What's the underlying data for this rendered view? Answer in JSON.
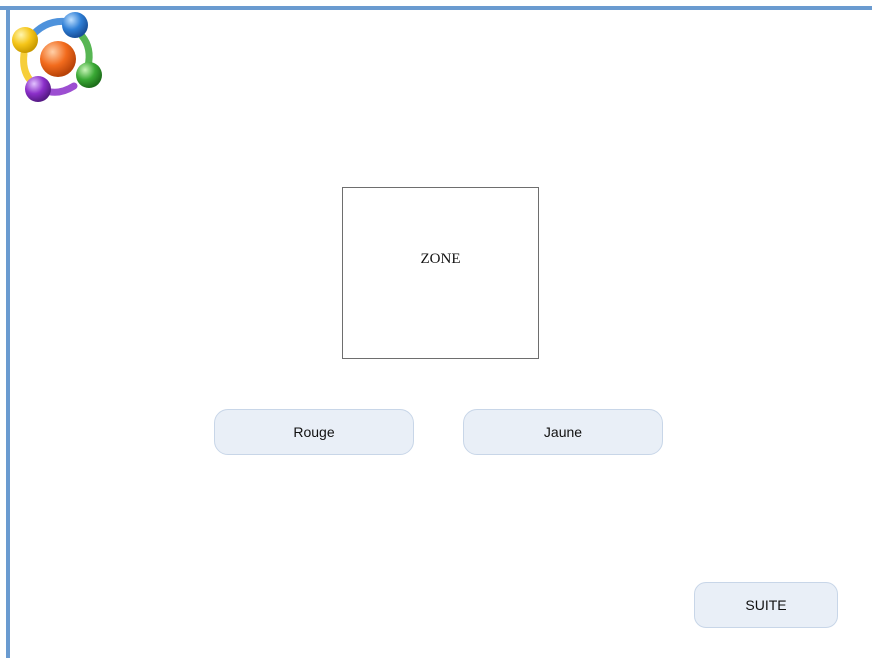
{
  "zone": {
    "label": "ZONE"
  },
  "buttons": {
    "rouge": "Rouge",
    "jaune": "Jaune",
    "suite": "SUITE"
  },
  "logo": {
    "icon": "colored-spheres-logo-icon",
    "colors": [
      "#f5c518",
      "#2f7fd6",
      "#f26b1d",
      "#3aa935",
      "#8b2fc9"
    ]
  },
  "colors": {
    "frame": "#6a9bd0",
    "button_bg": "#e9eff7",
    "button_border": "#c8d6e8"
  }
}
